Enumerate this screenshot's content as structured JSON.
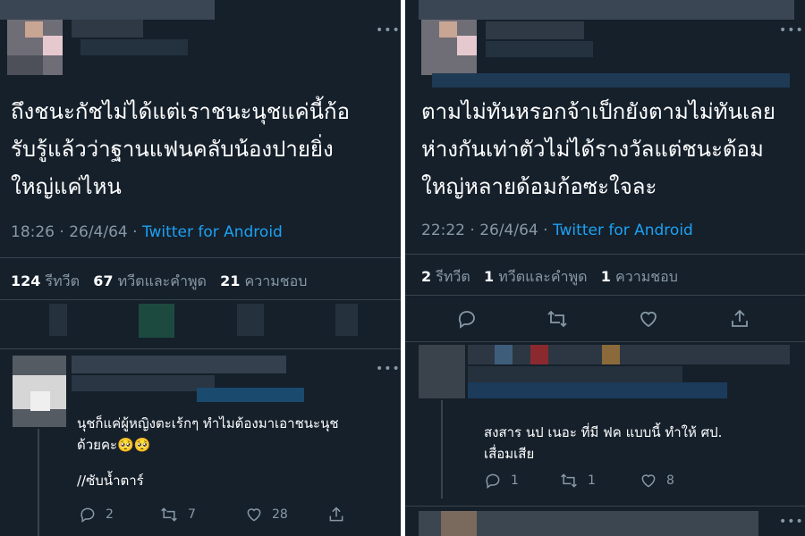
{
  "left_tweet": {
    "text_lines": [
      "ถึงชนะกัชไม่ได้แต่เราชนะนุชแค่นี้ก้อ",
      "รับรู้แล้วว่าฐานแฟนคลับน้องปายยิ่ง",
      "ใหญ่แค่ไหน"
    ],
    "time": "18:26 · 26/4/64 · ",
    "source": "Twitter for Android",
    "retweets_count": "124",
    "retweets_label": "รีทวีต",
    "quotes_count": "67",
    "quotes_label": "ทวีตและคำพูด",
    "likes_count": "21",
    "likes_label": "ความชอบ"
  },
  "left_reply": {
    "text_lines": [
      "นุชก็แค่ผู้หญิงตะเร้กๆ ทำไมต้องมาเอาชนะนุช",
      "ด้วยคะ🥺🥺"
    ],
    "tag": "//ซับน้ำตาร์",
    "reply_count": "2",
    "retweet_count": "7",
    "like_count": "28"
  },
  "right_tweet": {
    "text_lines": [
      "ตามไม่ทันหรอกจ้าเป็กยังตามไม่ทันเลย",
      "ห่างกันเท่าตัวไม่ได้รางวัลแต่ชนะด้อม",
      "ใหญ่หลายด้อมก้อซะใจละ"
    ],
    "time": "22:22 · 26/4/64 · ",
    "source": "Twitter for Android",
    "retweets_count": "2",
    "retweets_label": "รีทวีต",
    "quotes_count": "1",
    "quotes_label": "ทวีตและคำพูด",
    "likes_count": "1",
    "likes_label": "ความชอบ"
  },
  "right_reply": {
    "text_lines": [
      "สงสาร นป เนอะ ที่มี ฟค แบบนี้ ทำให้ ศป.",
      "เสื่อมเสีย"
    ],
    "reply_count": "1",
    "retweet_count": "1",
    "like_count": "8"
  },
  "more_icon": "•••",
  "colors": {
    "background": "#15202b",
    "text": "#ffffff",
    "muted": "#8899a6",
    "link": "#1da1f2",
    "divider": "#38444d"
  },
  "icons": [
    "reply-icon",
    "retweet-icon",
    "like-icon",
    "share-icon",
    "more-icon"
  ]
}
